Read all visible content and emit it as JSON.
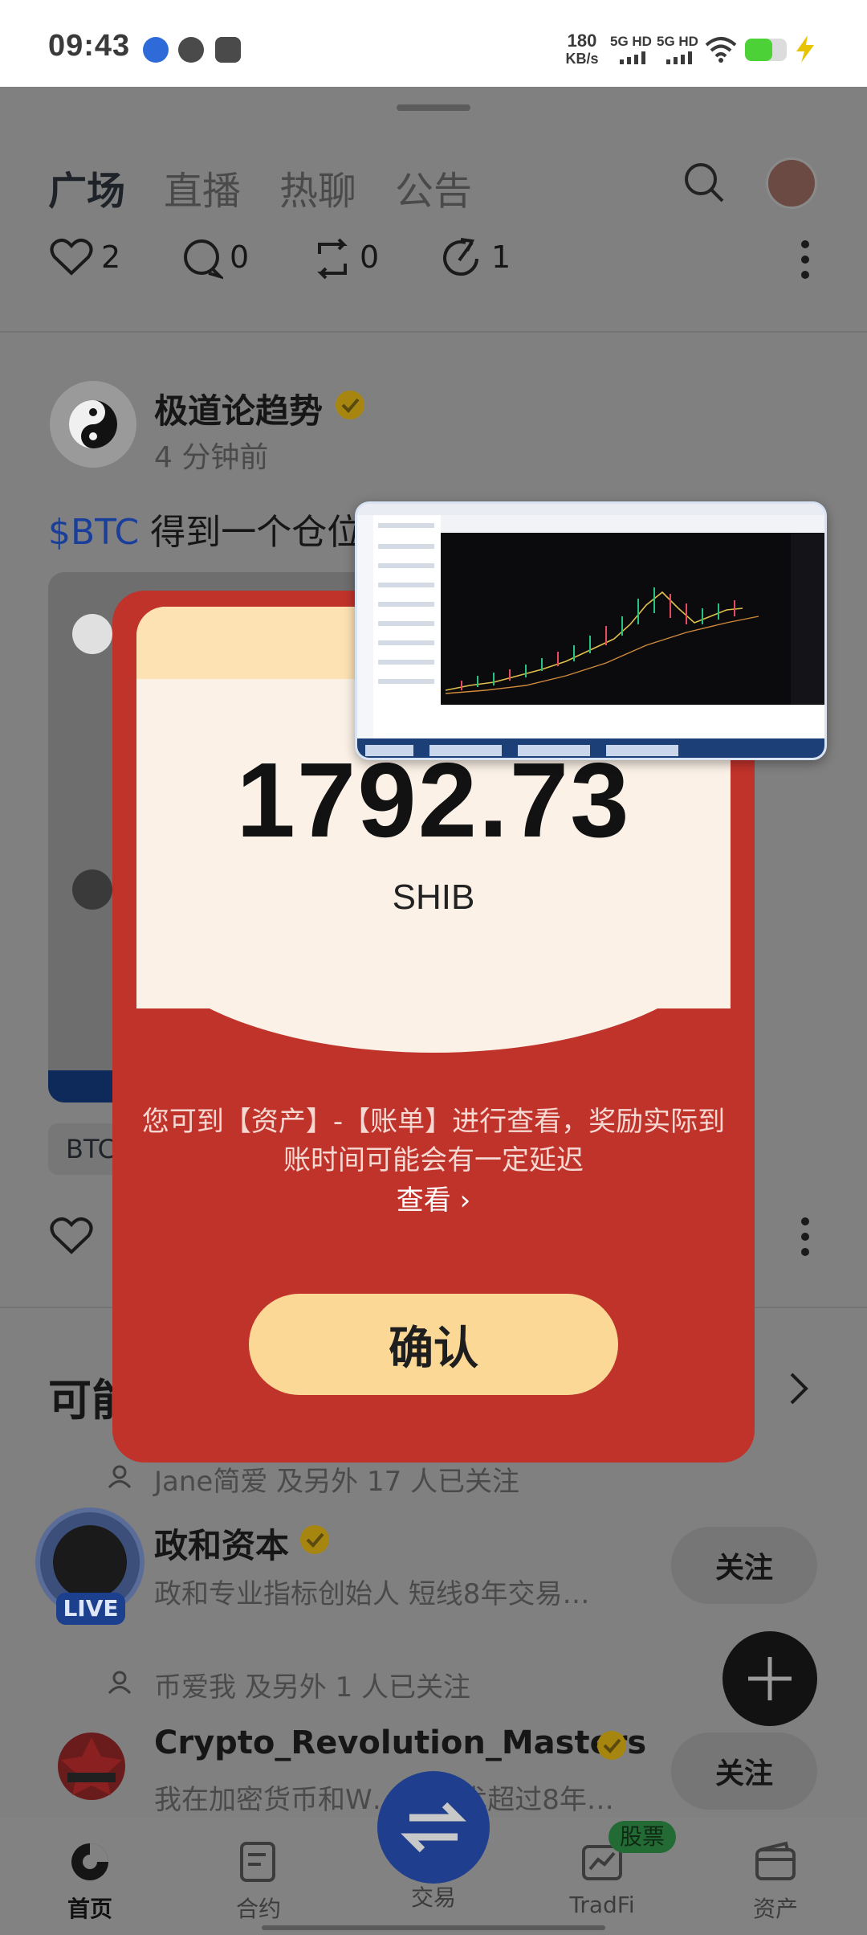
{
  "status_bar": {
    "time": "09:43",
    "net_speed_value": "180",
    "net_speed_unit": "KB/s",
    "sim1": "5G HD",
    "sim2": "5G HD"
  },
  "tabs": [
    "广场",
    "直播",
    "热聊",
    "公告"
  ],
  "post_actions": {
    "likes": "2",
    "comments": "0",
    "reposts": "0",
    "shares": "1"
  },
  "post": {
    "author": "极道论趋势",
    "time_ago": "4 分钟前",
    "ticker": "$BTC",
    "text": "得到一个仓位",
    "tag": "BTC"
  },
  "reward_modal": {
    "amount": "1792.73",
    "currency": "SHIB",
    "notice_line1": "您可到【资产】-【账单】进行查看，奖励实际到",
    "notice_line2": "账时间可能会有一定延迟",
    "view_link": "查看 ›",
    "confirm": "确认"
  },
  "suggest_heading": "可能",
  "suggestions": [
    {
      "followed_by": "Jane简爱 及另外 17 人已关注",
      "name": "政和资本",
      "bio": "政和专业指标创始人 短线8年交易…",
      "badge": "LIVE",
      "follow": "关注"
    },
    {
      "followed_by": "币爱我 及另外 1 人已关注",
      "name": "Crypto_Revolution_Masters",
      "bio": "我在加密货币和W…       术超过8年…",
      "follow": "关注"
    }
  ],
  "bottom_nav": [
    {
      "label": "首页",
      "icon": "home-icon"
    },
    {
      "label": "合约",
      "icon": "futures-icon"
    },
    {
      "label": "交易",
      "icon": "trade-swap-icon"
    },
    {
      "label": "TradFi",
      "icon": "tradfi-icon",
      "badge": "股票"
    },
    {
      "label": "资产",
      "icon": "wallet-icon"
    }
  ],
  "colors": {
    "modal_red": "#c0332b",
    "confirm_button": "#fcd896",
    "verified_badge": "#f0b90b",
    "trade_button": "#1f57d6",
    "live_badge": "#1c57d8",
    "stock_badge": "#2f9e44"
  }
}
